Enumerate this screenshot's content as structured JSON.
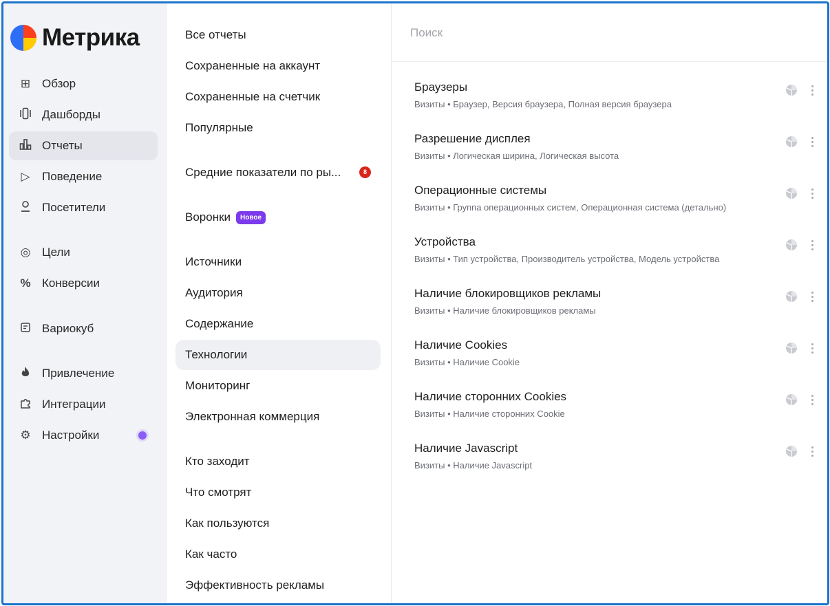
{
  "brand": {
    "name": "Метрика",
    "colors": {
      "blue": "#2e6df6",
      "red": "#fc3f1d",
      "yellow": "#ffcc00",
      "frame": "#1a73c9",
      "accent": "#7c3aed"
    }
  },
  "nav": {
    "items": [
      {
        "label": "Обзор",
        "icon": "grid-icon"
      },
      {
        "label": "Дашборды",
        "icon": "dashboards-icon"
      },
      {
        "label": "Отчеты",
        "icon": "reports-icon",
        "active": true
      },
      {
        "label": "Поведение",
        "icon": "play-icon"
      },
      {
        "label": "Посетители",
        "icon": "user-icon"
      },
      {
        "label": "Цели",
        "icon": "target-icon"
      },
      {
        "label": "Конверсии",
        "icon": "percent-icon"
      },
      {
        "label": "Вариокуб",
        "icon": "variocube-icon"
      },
      {
        "label": "Привлечение",
        "icon": "flame-icon"
      },
      {
        "label": "Интеграции",
        "icon": "puzzle-icon"
      },
      {
        "label": "Настройки",
        "icon": "gear-icon",
        "dot": true
      }
    ]
  },
  "categories": {
    "items": [
      {
        "label": "Все отчеты"
      },
      {
        "label": "Сохраненные на аккаунт"
      },
      {
        "label": "Сохраненные на счетчик"
      },
      {
        "label": "Популярные"
      },
      {
        "label": "Средние показатели по ры...",
        "badge": "8"
      },
      {
        "label": "Воронки",
        "new_badge": "Новое"
      },
      {
        "label": "Источники"
      },
      {
        "label": "Аудитория"
      },
      {
        "label": "Содержание"
      },
      {
        "label": "Технологии",
        "active": true
      },
      {
        "label": "Мониторинг"
      },
      {
        "label": "Электронная коммерция"
      },
      {
        "label": "Кто заходит"
      },
      {
        "label": "Что смотрят"
      },
      {
        "label": "Как пользуются"
      },
      {
        "label": "Как часто"
      },
      {
        "label": "Эффективность рекламы"
      }
    ]
  },
  "search": {
    "placeholder": "Поиск",
    "value": ""
  },
  "reports": [
    {
      "title": "Браузеры",
      "subtitle": "Визиты • Браузер, Версия браузера, Полная версия браузера"
    },
    {
      "title": "Разрешение дисплея",
      "subtitle": "Визиты • Логическая ширина, Логическая высота"
    },
    {
      "title": "Операционные системы",
      "subtitle": "Визиты • Группа операционных систем, Операционная система (детально)"
    },
    {
      "title": "Устройства",
      "subtitle": "Визиты • Тип устройства, Производитель устройства, Модель устройства"
    },
    {
      "title": "Наличие блокировщиков рекламы",
      "subtitle": "Визиты • Наличие блокировщиков рекламы"
    },
    {
      "title": "Наличие Cookies",
      "subtitle": "Визиты • Наличие Cookie"
    },
    {
      "title": "Наличие сторонних Cookies",
      "subtitle": "Визиты • Наличие сторонних Cookie"
    },
    {
      "title": "Наличие Javascript",
      "subtitle": "Визиты • Наличие Javascript"
    }
  ]
}
